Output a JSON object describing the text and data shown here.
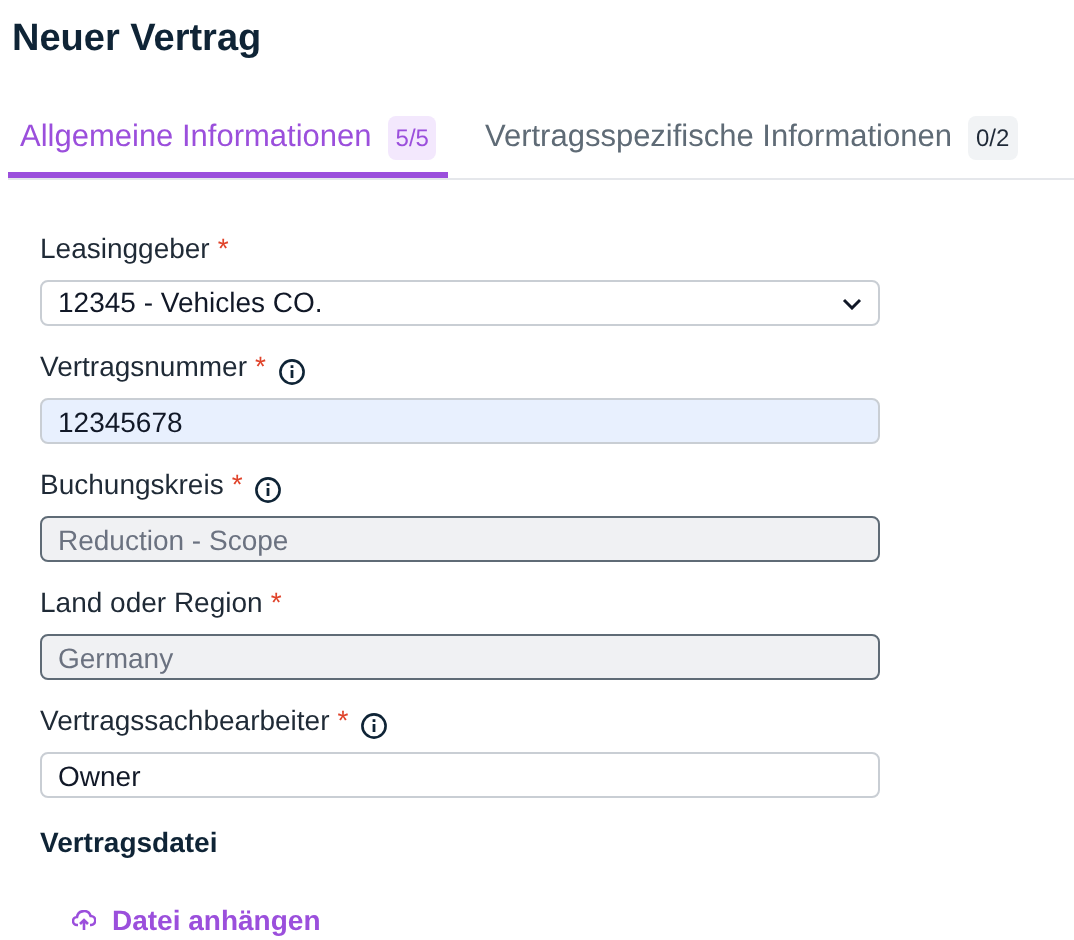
{
  "title": "Neuer Vertrag",
  "tabs": [
    {
      "label": "Allgemeine Informationen",
      "count": "5/5",
      "selected": true
    },
    {
      "label": "Vertragsspezifische Informationen",
      "count": "0/2",
      "selected": false
    }
  ],
  "fields": [
    {
      "label": "Leasinggeber",
      "required_mark": "*",
      "info": false,
      "kind": "select",
      "value": "12345 - Vehicles CO."
    },
    {
      "label": "Vertragsnummer",
      "required_mark": "*",
      "info": true,
      "kind": "autofilled",
      "value": "12345678"
    },
    {
      "label": "Buchungskreis",
      "required_mark": "*",
      "info": true,
      "kind": "disabled",
      "value": "Reduction - Scope"
    },
    {
      "label": "Land oder Region",
      "required_mark": "*",
      "info": false,
      "kind": "disabled",
      "value": "Germany"
    },
    {
      "label": "Vertragssachbearbeiter",
      "required_mark": "*",
      "info": true,
      "kind": "input",
      "value": "Owner"
    }
  ],
  "attachment": {
    "heading": "Vertragsdatei",
    "link": "Datei anhängen"
  }
}
